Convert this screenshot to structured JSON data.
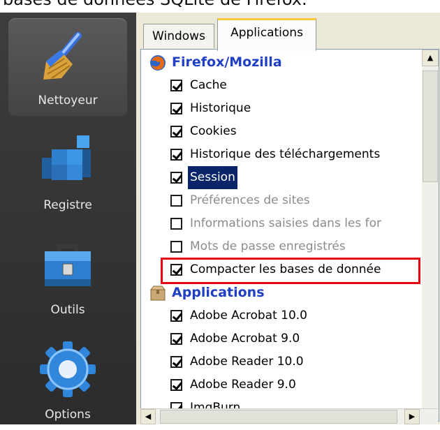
{
  "caption": "bases de données SQLite de Firefox.",
  "sidebar": {
    "items": [
      {
        "label": "Nettoyeur",
        "icon": "broom-icon"
      },
      {
        "label": "Registre",
        "icon": "registry-cubes-icon"
      },
      {
        "label": "Outils",
        "icon": "toolbox-icon"
      },
      {
        "label": "Options",
        "icon": "gear-icon"
      }
    ]
  },
  "tabs": [
    {
      "label": "Windows"
    },
    {
      "label": "Applications"
    }
  ],
  "list": {
    "group_firefox": "Firefox/Mozilla",
    "firefox_items": [
      {
        "label": "Cache",
        "checked": true
      },
      {
        "label": "Historique",
        "checked": true
      },
      {
        "label": "Cookies",
        "checked": true
      },
      {
        "label": "Historique des téléchargements",
        "checked": true
      },
      {
        "label": "Session",
        "checked": true
      },
      {
        "label": "Préférences de sites",
        "checked": false
      },
      {
        "label": "Informations saisies dans les for",
        "checked": false
      },
      {
        "label": "Mots de passe enregistrés",
        "checked": false
      },
      {
        "label": "Compacter les bases de donnée",
        "checked": true
      }
    ],
    "group_apps": "Applications",
    "app_items": [
      {
        "label": "Adobe Acrobat 10.0",
        "checked": true
      },
      {
        "label": "Adobe Acrobat 9.0",
        "checked": true
      },
      {
        "label": "Adobe Reader 10.0",
        "checked": true
      },
      {
        "label": "Adobe Reader 9.0",
        "checked": true
      },
      {
        "label": "ImgBurn",
        "checked": true
      }
    ]
  },
  "colors": {
    "highlight_border": "#e3000f",
    "group_text": "#1f3fc4",
    "selection_bg": "#0a246a"
  }
}
